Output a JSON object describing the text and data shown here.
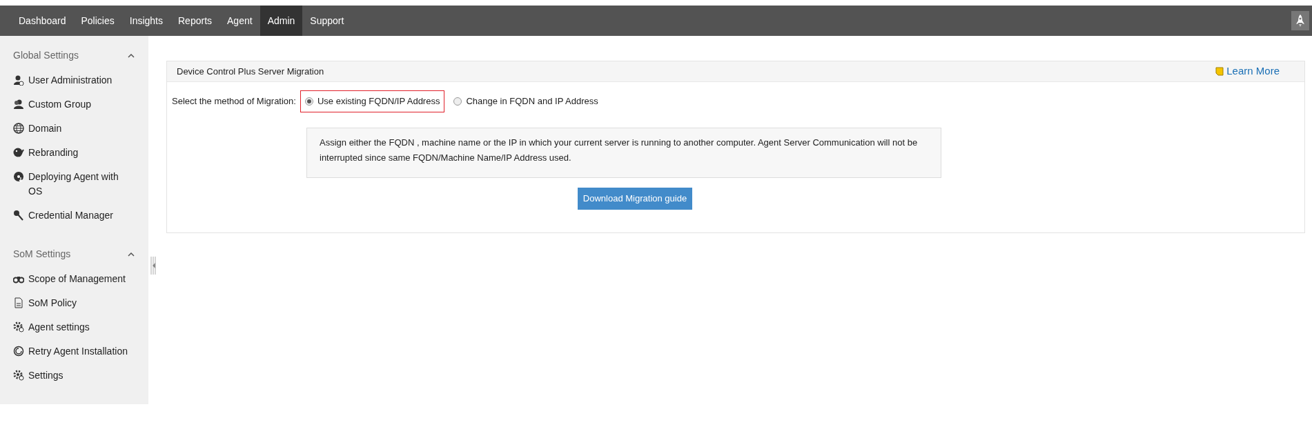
{
  "nav": {
    "items": [
      {
        "label": "Dashboard",
        "selected": false
      },
      {
        "label": "Policies",
        "selected": false
      },
      {
        "label": "Insights",
        "selected": false
      },
      {
        "label": "Reports",
        "selected": false
      },
      {
        "label": "Agent",
        "selected": false
      },
      {
        "label": "Admin",
        "selected": true
      },
      {
        "label": "Support",
        "selected": false
      }
    ]
  },
  "sidebar": {
    "sections": [
      {
        "title": "Global Settings",
        "expanded": true,
        "items": [
          {
            "label": "User Administration"
          },
          {
            "label": "Custom Group"
          },
          {
            "label": "Domain"
          },
          {
            "label": "Rebranding"
          },
          {
            "label": "Deploying Agent with OS"
          },
          {
            "label": "Credential Manager"
          }
        ]
      },
      {
        "title": "SoM Settings",
        "expanded": true,
        "items": [
          {
            "label": "Scope of Management"
          },
          {
            "label": "SoM Policy"
          },
          {
            "label": "Agent settings"
          },
          {
            "label": "Retry Agent Installation"
          },
          {
            "label": "Settings"
          }
        ]
      }
    ]
  },
  "panel": {
    "title": "Device Control Plus Server Migration",
    "learn_more": "Learn More",
    "method_label": "Select the method of Migration:",
    "options": [
      {
        "label": "Use existing FQDN/IP Address",
        "selected": true,
        "highlighted": true
      },
      {
        "label": "Change in FQDN and IP Address",
        "selected": false,
        "highlighted": false
      }
    ],
    "info": "Assign either the FQDN , machine name or the IP in which your current server is running to another computer. Agent Server Communication will not be interrupted since same FQDN/Machine Name/IP Address used.",
    "button": "Download Migration guide"
  }
}
